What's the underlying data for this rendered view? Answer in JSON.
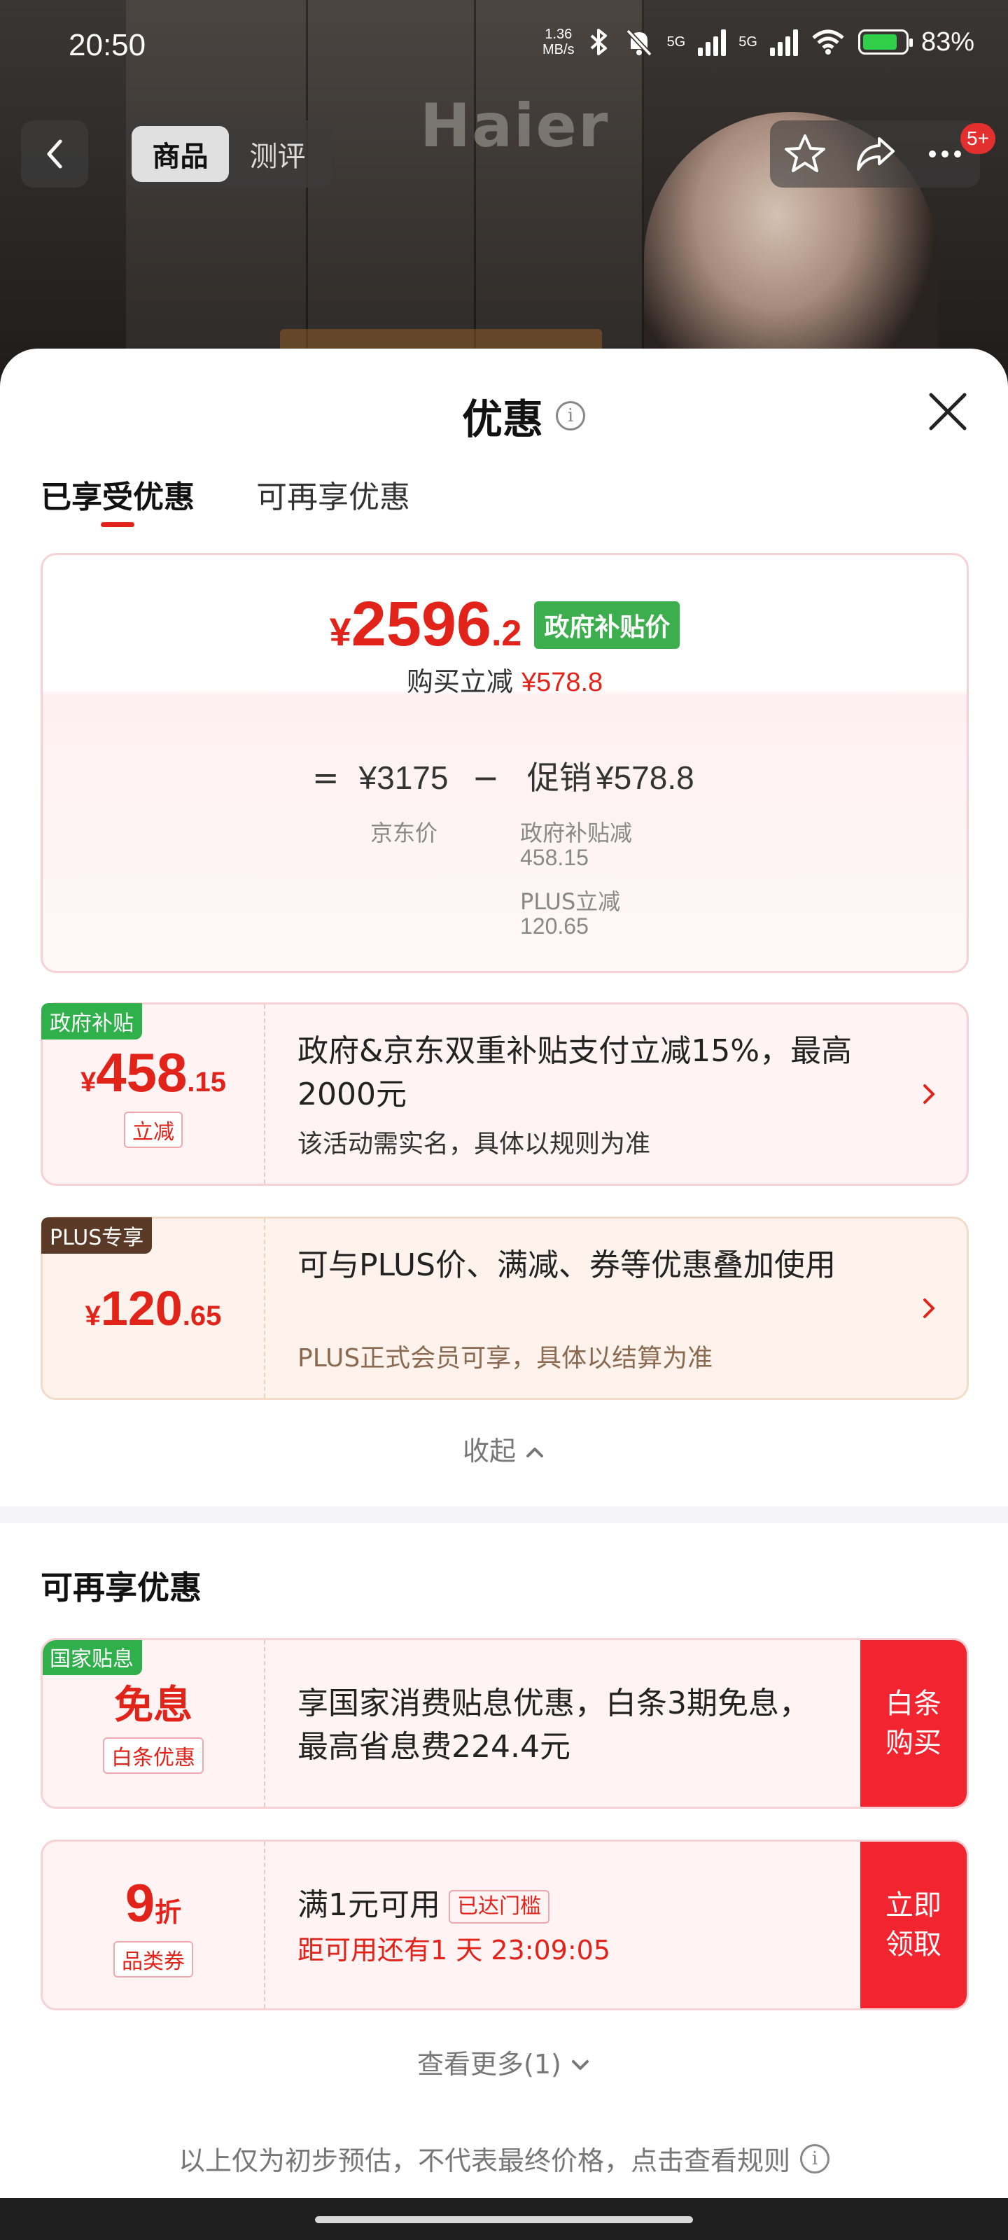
{
  "status_bar": {
    "time": "20:50",
    "net_speed_value": "1.36",
    "net_speed_unit": "MB/s",
    "sim1": "5G",
    "sim2": "5G",
    "battery": "83%"
  },
  "header": {
    "tabs": [
      {
        "label": "商品",
        "active": true
      },
      {
        "label": "测评",
        "active": false
      }
    ],
    "brand_watermark": "Haier",
    "notification_badge": "5+"
  },
  "sheet": {
    "title": "优惠",
    "tabs": [
      {
        "label": "已享受优惠",
        "active": true
      },
      {
        "label": "可再享优惠",
        "active": false
      }
    ]
  },
  "price_summary": {
    "currency": "¥",
    "price_int": "2596",
    "price_dec": ".2",
    "tag": "政府补贴价",
    "subtitle_label": "购买立减",
    "subtitle_value": "¥578.8",
    "equals": "=",
    "jd_price": "¥3175",
    "minus": "−",
    "promo_label": "促销",
    "promo_value": "¥578.8",
    "jd_price_label": "京东价",
    "detail1_label": "政府补贴减",
    "detail1_value": "458.15",
    "detail2_label": "PLUS立减",
    "detail2_value": "120.65"
  },
  "coupons_enjoyed": [
    {
      "corner_tag": "政府补贴",
      "currency": "¥",
      "amount_int": "458",
      "amount_dec": ".15",
      "small_tag": "立减",
      "description": "政府&京东双重补贴支付立减15%，最高2000元",
      "note": "该活动需实名，具体以规则为准"
    },
    {
      "corner_tag": "PLUS专享",
      "currency": "¥",
      "amount_int": "120",
      "amount_dec": ".65",
      "description": "可与PLUS价、满减、券等优惠叠加使用",
      "note": "PLUS正式会员可享，具体以结算为准"
    }
  ],
  "collapse_label": "收起",
  "more_section": {
    "title": "可再享优惠",
    "items": [
      {
        "corner_tag": "国家贴息",
        "main": "免息",
        "small_tag": "白条优惠",
        "description": "享国家消费贴息优惠，白条3期免息，最高省息费224.4元",
        "action": "白条购买"
      },
      {
        "main_num": "9",
        "main_unit": "折",
        "small_tag": "品类券",
        "description": "满1元可用",
        "reached_tag": "已达门槛",
        "countdown": "距可用还有1 天 23:09:05",
        "action": "立即领取"
      }
    ],
    "see_more": "查看更多(1)"
  },
  "footer_note": "以上仅为初步预估，不代表最终价格，点击查看规则",
  "colors": {
    "accent_red": "#e2231a",
    "button_red": "#f1242f",
    "gov_green": "#3cae4e",
    "plus_brown": "#5a3a26"
  }
}
